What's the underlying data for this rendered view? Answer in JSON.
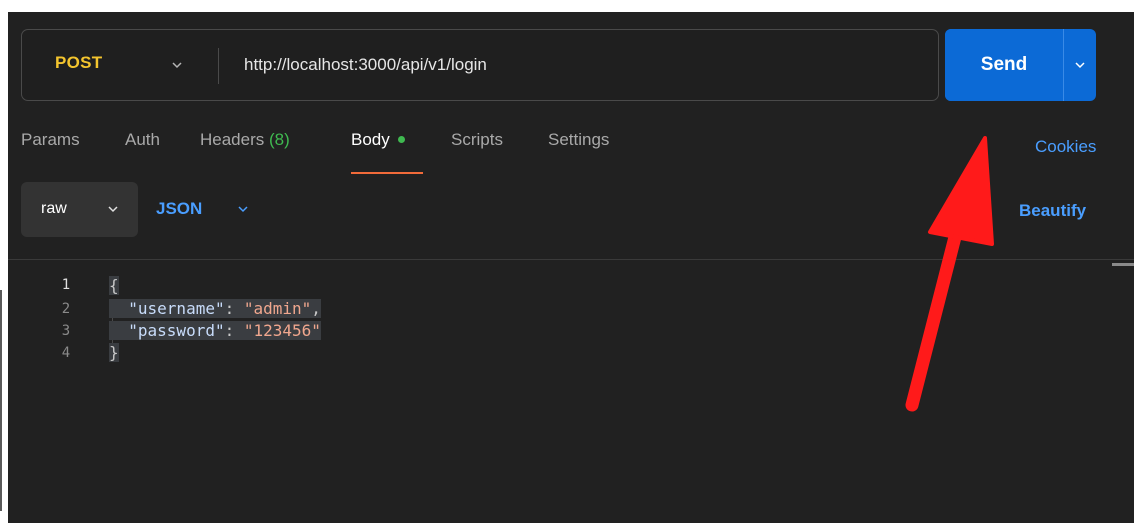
{
  "request": {
    "method": "POST",
    "url": "http://localhost:3000/api/v1/login",
    "send_label": "Send"
  },
  "tabs": [
    {
      "label": "Params"
    },
    {
      "label": "Auth"
    },
    {
      "label": "Headers",
      "count": "(8)"
    },
    {
      "label": "Body",
      "active": true,
      "dot": true
    },
    {
      "label": "Scripts"
    },
    {
      "label": "Settings"
    }
  ],
  "cookies_label": "Cookies",
  "body_options": {
    "mode": "raw",
    "language": "JSON",
    "beautify_label": "Beautify"
  },
  "editor": {
    "lines": [
      {
        "num": "1",
        "text": "{"
      },
      {
        "num": "2",
        "key": "\"username\"",
        "value": "\"admin\"",
        "trailing": ","
      },
      {
        "num": "3",
        "key": "\"password\"",
        "value": "\"123456\"",
        "trailing": ""
      },
      {
        "num": "4",
        "text": "}"
      }
    ]
  },
  "colors": {
    "method": "#f4c52e",
    "send": "#0c6ad6",
    "link": "#4a9eff",
    "active_underline": "#f26b3a",
    "status_dot": "#3fb950",
    "annotation_arrow": "#ff1a1a"
  },
  "icons": {
    "method_dropdown": "chevron-down-icon",
    "send_dropdown": "chevron-down-icon",
    "mode_dropdown": "chevron-down-icon",
    "language_dropdown": "chevron-down-icon",
    "annotation": "red-arrow-icon"
  }
}
